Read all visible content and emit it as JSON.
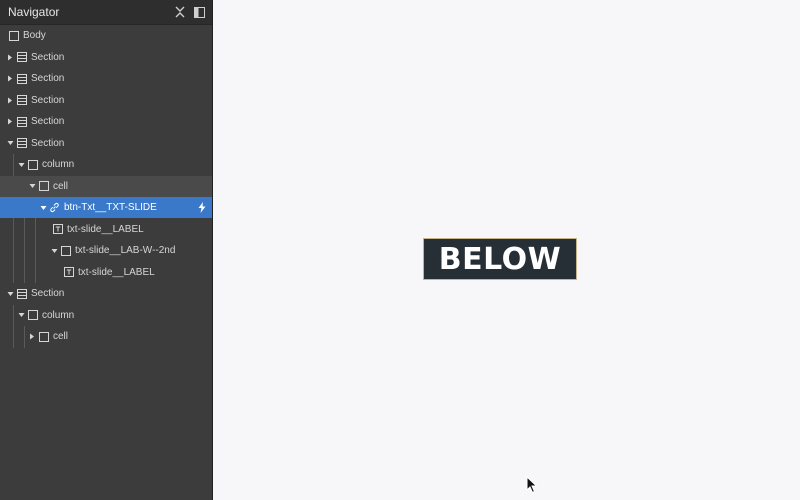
{
  "navigator": {
    "title": "Navigator",
    "icons": [
      "collapse-all-icon",
      "panel-toggle-icon"
    ],
    "tree": [
      {
        "label": "Body",
        "icon": "body-icon",
        "depth": 0,
        "caret": "none"
      },
      {
        "label": "Section",
        "icon": "section-icon",
        "depth": 0,
        "caret": "right"
      },
      {
        "label": "Section",
        "icon": "section-icon",
        "depth": 0,
        "caret": "right"
      },
      {
        "label": "Section",
        "icon": "section-icon",
        "depth": 0,
        "caret": "right"
      },
      {
        "label": "Section",
        "icon": "section-icon",
        "depth": 0,
        "caret": "right"
      },
      {
        "label": "Section",
        "icon": "section-icon",
        "depth": 0,
        "caret": "down"
      },
      {
        "label": "column",
        "icon": "div-icon",
        "depth": 1,
        "caret": "down"
      },
      {
        "label": "cell",
        "icon": "div-icon",
        "depth": 2,
        "caret": "down",
        "state": "hover"
      },
      {
        "label": "btn-Txt__TXT-SLIDE",
        "icon": "link-icon",
        "depth": 3,
        "caret": "down",
        "state": "selected",
        "badge": "bolt-icon"
      },
      {
        "label": "txt-slide__LABEL",
        "icon": "text-icon",
        "depth": 4,
        "caret": "none"
      },
      {
        "label": "txt-slide__LAB-W--2nd",
        "icon": "div-icon",
        "depth": 4,
        "caret": "down"
      },
      {
        "label": "txt-slide__LABEL",
        "icon": "text-icon",
        "depth": 5,
        "caret": "none"
      },
      {
        "label": "Section",
        "icon": "section-icon",
        "depth": 0,
        "caret": "down"
      },
      {
        "label": "column",
        "icon": "div-icon",
        "depth": 1,
        "caret": "down"
      },
      {
        "label": "cell",
        "icon": "div-icon",
        "depth": 2,
        "caret": "right"
      }
    ]
  },
  "canvas": {
    "button_text": "BELOW",
    "button_bg": "#262f36",
    "background": "#f7f7f9"
  },
  "colors": {
    "panel": "#3c3c3c",
    "selected": "#3a78c9"
  }
}
